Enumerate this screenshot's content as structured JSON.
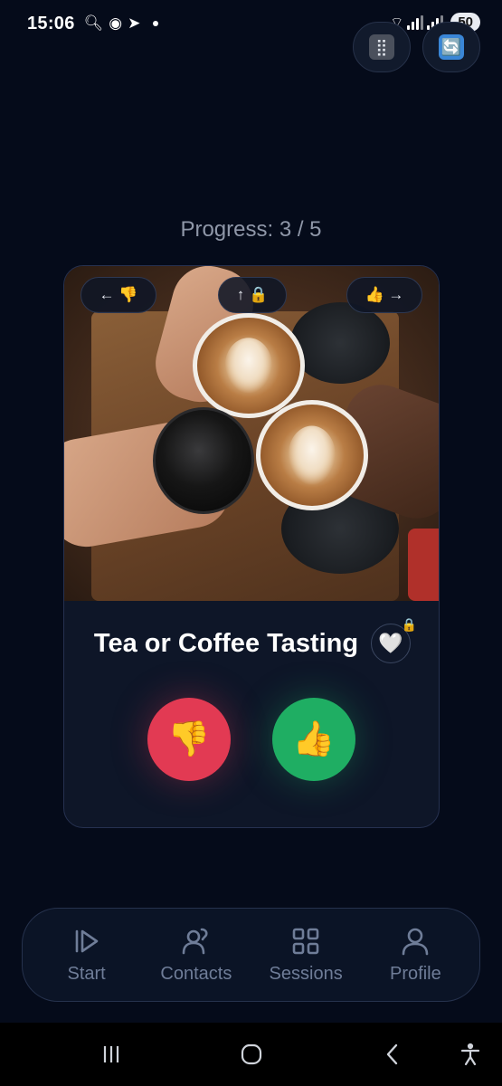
{
  "status_bar": {
    "time": "15:06",
    "battery": "50"
  },
  "top_buttons": {
    "grid_glyph": "⣿",
    "swap_glyph": "🔄"
  },
  "progress": {
    "text": "Progress: 3 / 5",
    "current": 3,
    "total": 5
  },
  "card": {
    "title": "Tea or Coffee Tasting",
    "hint_left": "← 👎",
    "hint_up": "↑ 🔒",
    "hint_right": "👍 →",
    "favorite_glyph": "🤍",
    "favorite_lock_glyph": "🔒",
    "dislike_glyph": "👎",
    "like_glyph": "👍",
    "image_description_icon": "coffee-cups-photo"
  },
  "bottom_nav": {
    "items": [
      {
        "label": "Start",
        "icon": "start-icon"
      },
      {
        "label": "Contacts",
        "icon": "contacts-icon"
      },
      {
        "label": "Sessions",
        "icon": "sessions-icon"
      },
      {
        "label": "Profile",
        "icon": "profile-icon"
      }
    ]
  },
  "colors": {
    "background": "#050b1a",
    "card_bg": "#0e1628",
    "dislike": "#e23a53",
    "like": "#1fae63",
    "nav_text": "#6f7d98"
  }
}
